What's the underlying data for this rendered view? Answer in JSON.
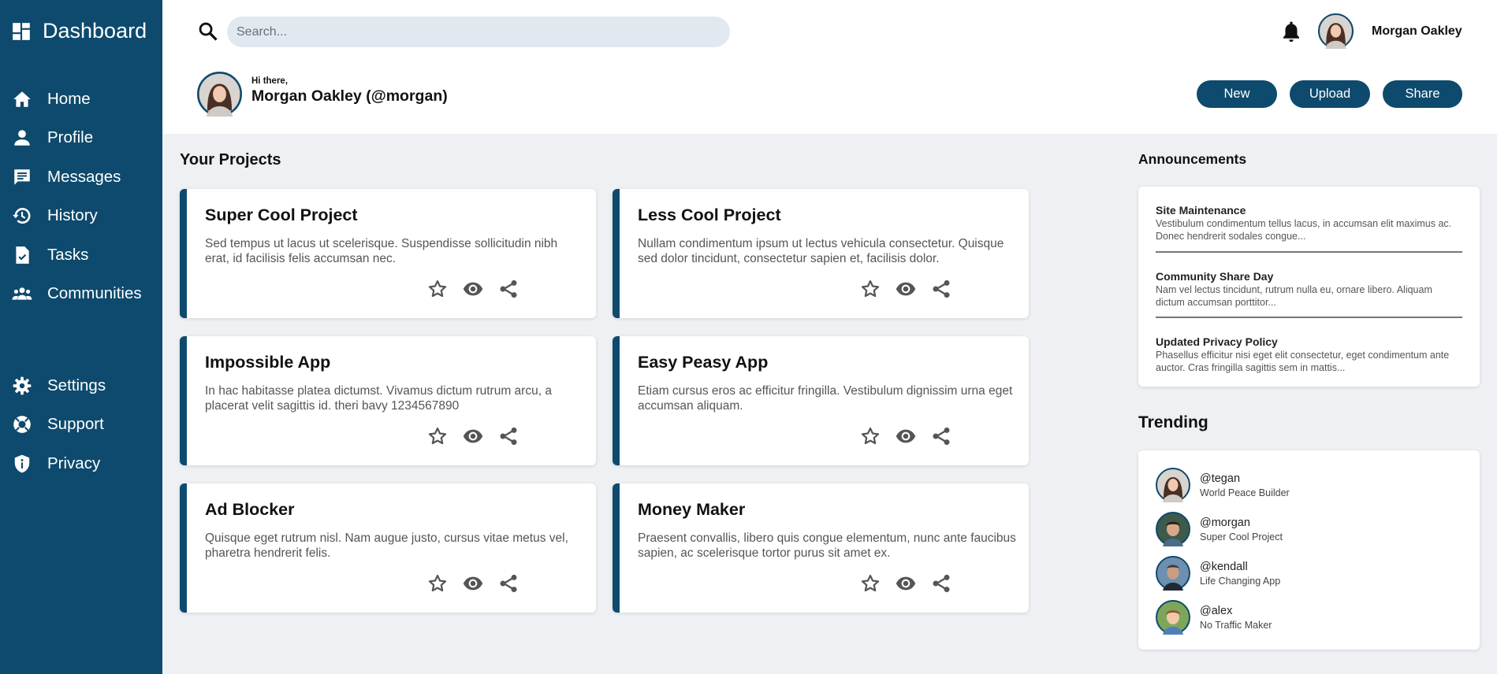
{
  "colors": {
    "primary": "#0e4a6d",
    "background": "#eef0f3",
    "card": "#ffffff"
  },
  "sidebar": {
    "brand": "Dashboard",
    "nav": [
      {
        "label": "Home",
        "icon": "home-icon"
      },
      {
        "label": "Profile",
        "icon": "person-icon"
      },
      {
        "label": "Messages",
        "icon": "chat-icon"
      },
      {
        "label": "History",
        "icon": "history-icon"
      },
      {
        "label": "Tasks",
        "icon": "task-icon"
      },
      {
        "label": "Communities",
        "icon": "group-icon"
      }
    ],
    "nav_secondary": [
      {
        "label": "Settings",
        "icon": "gear-icon"
      },
      {
        "label": "Support",
        "icon": "lifebuoy-icon"
      },
      {
        "label": "Privacy",
        "icon": "shield-icon"
      }
    ]
  },
  "header": {
    "search_placeholder": "Search...",
    "user_name": "Morgan Oakley",
    "greeting": "Hi there,",
    "hero_name": "Morgan Oakley (@morgan)",
    "buttons": {
      "new": "New",
      "upload": "Upload",
      "share": "Share"
    }
  },
  "projects": {
    "title": "Your Projects",
    "items": [
      {
        "title": "Super Cool Project",
        "desc": "Sed tempus ut lacus ut scelerisque. Suspendisse sollicitudin nibh erat, id facilisis felis accumsan nec."
      },
      {
        "title": "Less Cool Project",
        "desc": "Nullam condimentum ipsum ut lectus vehicula consectetur. Quisque sed dolor tincidunt, consectetur sapien et, facilisis dolor."
      },
      {
        "title": "Impossible App",
        "desc": "In hac habitasse platea dictumst. Vivamus dictum rutrum arcu, a placerat velit sagittis id. theri bavy 1234567890"
      },
      {
        "title": "Easy Peasy App",
        "desc": "Etiam cursus eros ac efficitur fringilla. Vestibulum dignissim urna eget accumsan aliquam."
      },
      {
        "title": "Ad Blocker",
        "desc": "Quisque eget rutrum nisl. Nam augue justo, cursus vitae metus vel, pharetra hendrerit felis."
      },
      {
        "title": "Money Maker",
        "desc": "Praesent convallis, libero quis congue elementum, nunc ante faucibus sapien, ac scelerisque tortor purus sit amet ex."
      }
    ]
  },
  "announcements": {
    "title": "Announcements",
    "items": [
      {
        "title": "Site Maintenance",
        "text": "Vestibulum condimentum tellus lacus, in accumsan elit maximus ac. Donec hendrerit sodales congue..."
      },
      {
        "title": "Community Share Day",
        "text": "Nam vel lectus tincidunt, rutrum nulla eu, ornare libero. Aliquam dictum accumsan porttitor..."
      },
      {
        "title": "Updated Privacy Policy",
        "text": "Phasellus efficitur nisi eget elit consectetur, eget condimentum ante auctor. Cras fringilla sagittis sem in mattis..."
      }
    ]
  },
  "trending": {
    "title": "Trending",
    "items": [
      {
        "handle": "@tegan",
        "project": "World Peace Builder"
      },
      {
        "handle": "@morgan",
        "project": "Super Cool Project"
      },
      {
        "handle": "@kendall",
        "project": "Life Changing App"
      },
      {
        "handle": "@alex",
        "project": "No Traffic Maker"
      }
    ]
  }
}
